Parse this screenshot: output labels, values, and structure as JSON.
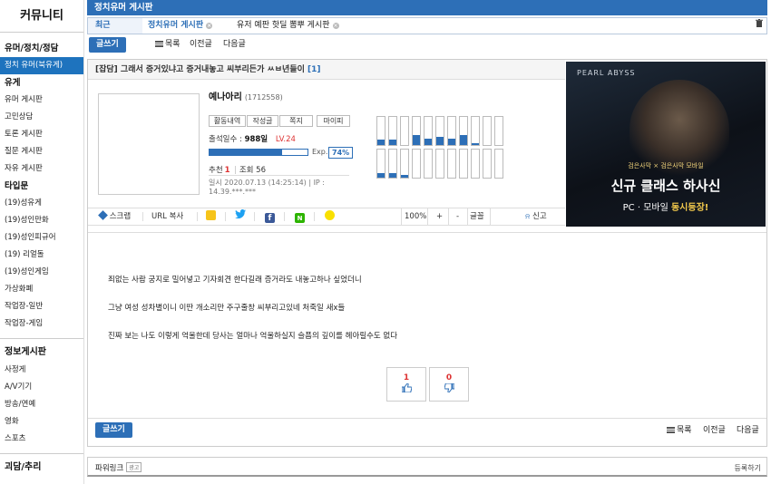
{
  "sidebar": {
    "brand": "커뮤니티",
    "groups": [
      {
        "title": "유머/정치/정담",
        "items": [
          "정치 유머(북유게)"
        ]
      },
      {
        "title": "유게",
        "items": [
          "유머 게시판",
          "고민상담",
          "토론 게시판",
          "질문 게시판",
          "자유 게시판"
        ]
      },
      {
        "title": "타입문",
        "items": [
          "(19)성유게",
          "(19)성인만화",
          "(19)성인피규어",
          "(19) 리얼돌",
          "(19)성인게임",
          "가상화폐",
          "작업장-일반",
          "작업장-게임"
        ]
      },
      {
        "title": "정보게시판",
        "items": [
          "사정게",
          "A/V기기",
          "방송/연예",
          "영화",
          "스포츠"
        ]
      },
      {
        "title": "괴담/추리",
        "items": []
      }
    ]
  },
  "titlebar": {
    "title": "정치유머 게시판"
  },
  "recent": {
    "label": "최근",
    "chips": [
      {
        "text": "정치유머 게시판",
        "active": true
      },
      {
        "text": "유저 예판 핫딜 뽐뿌 게시판",
        "active": false
      }
    ]
  },
  "toolbar": {
    "write": "글쓰기",
    "list": "목록",
    "prev": "이전글",
    "next": "다음글"
  },
  "post": {
    "subject_prefix": "[잡담] 그래서 증거있냐고 증거내놓고 씨부리든가 ㅆㅂ년들이",
    "comment_count": "[1]",
    "nickname": "예나아리",
    "user_id": "(1712558)",
    "profile_buttons": [
      "활동내역",
      "작성글",
      "쪽지",
      "마이피"
    ],
    "attendance_label": "출석일수 :",
    "attendance_value": "988일",
    "level": "LV.24",
    "exp_label": "Exp.",
    "exp_pct": "74%",
    "exp_fraction": 0.74,
    "recommend_label": "추천",
    "recommend_value": "1",
    "views": "조회 56",
    "date_ip": "일시 2020.07.13 (14:25:14) | IP : 14.39.***.***",
    "activity_bars": [
      0.2,
      0.2,
      0.0,
      0.35,
      0.22,
      0.28,
      0.22,
      0.35,
      0.05,
      0,
      0,
      0.15,
      0.15,
      0.1,
      0,
      0,
      0,
      0,
      0,
      0,
      0,
      0
    ],
    "actions": {
      "scrap": "스크랩",
      "url": "URL 복사",
      "zoom": "100%",
      "plus": "+",
      "minus": "-",
      "font": "글꼴",
      "report": "신고"
    },
    "paragraphs": [
      "죄없는 사람 궁지로 밀어넣고 기자회견 한다길래 증거라도 내놓고하나 싶었더니",
      "그냥 여성 성차별이니 이딴 개소리만 주구줄창 씨부리고있네 처죽일 새x들",
      "진짜 보는 나도 이렇게 억울한데 당사는 얼마나 억울하실지 슬픔의 깊이를 헤아릴수도 없다"
    ],
    "upvotes": "1",
    "downvotes": "0"
  },
  "ad": {
    "brand": "PEARL ABYSS",
    "sub": "검은사막 × 검은사막 모바일",
    "headline": "신규 클래스 하사신",
    "platform_prefix": "PC · 모바일",
    "platform_highlight": "동시등장!"
  },
  "power": {
    "label": "파워링크",
    "tag": "광고",
    "register": "등록하기"
  },
  "colors": {
    "accent": "#2d6fb7",
    "red": "#d33333"
  }
}
